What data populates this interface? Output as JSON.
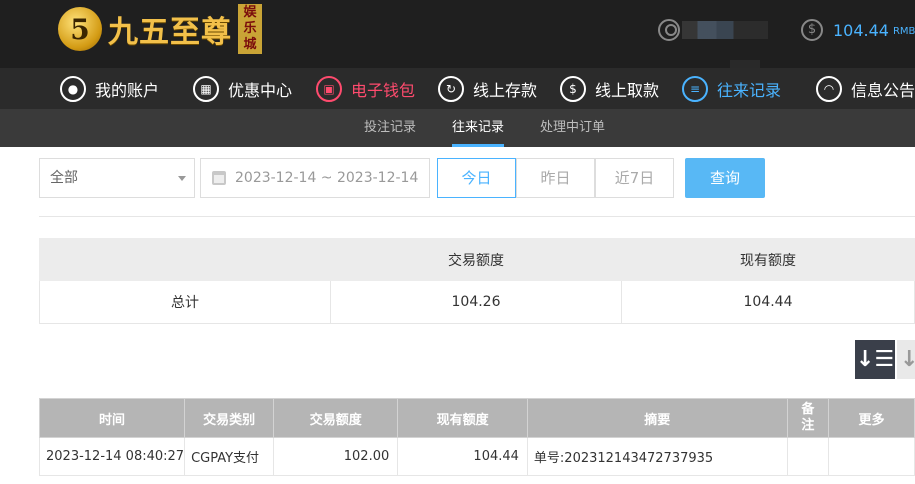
{
  "header": {
    "logo_badge": "5",
    "logo_text": "九五至尊",
    "logo_tag": "娱乐城",
    "balance": "104.44",
    "currency": "RMB",
    "accent_color": "#4ab3ff"
  },
  "main_nav": [
    {
      "label": "我的账户",
      "icon": "user-icon"
    },
    {
      "label": "优惠中心",
      "icon": "gift-icon"
    },
    {
      "label": "电子钱包",
      "icon": "wallet-icon",
      "active": true
    },
    {
      "label": "线上存款",
      "icon": "deposit-icon"
    },
    {
      "label": "线上取款",
      "icon": "withdraw-icon"
    },
    {
      "label": "往来记录",
      "icon": "records-icon"
    },
    {
      "label": "信息公告",
      "icon": "bell-icon"
    }
  ],
  "sub_nav": [
    {
      "label": "投注记录"
    },
    {
      "label": "往来记录",
      "active": true
    },
    {
      "label": "处理中订单"
    }
  ],
  "filters": {
    "type_select": "全部",
    "date_range": "2023-12-14 ~ 2023-12-14",
    "today": "今日",
    "yesterday": "昨日",
    "last7": "近7日",
    "query": "查询"
  },
  "summary": {
    "col1": "交易额度",
    "col2": "现有额度",
    "row_label": "总计",
    "trade_total": "104.26",
    "current_total": "104.44"
  },
  "table": {
    "headers": [
      "时间",
      "交易类别",
      "交易额度",
      "现有额度",
      "摘要",
      "备注",
      "更多"
    ],
    "rows": [
      {
        "time": "2023-12-14 08:40:27",
        "type": "CGPAY支付",
        "amount": "102.00",
        "balance": "104.44",
        "summary": "单号:202312143472737935",
        "remark": "",
        "more": ""
      }
    ]
  }
}
